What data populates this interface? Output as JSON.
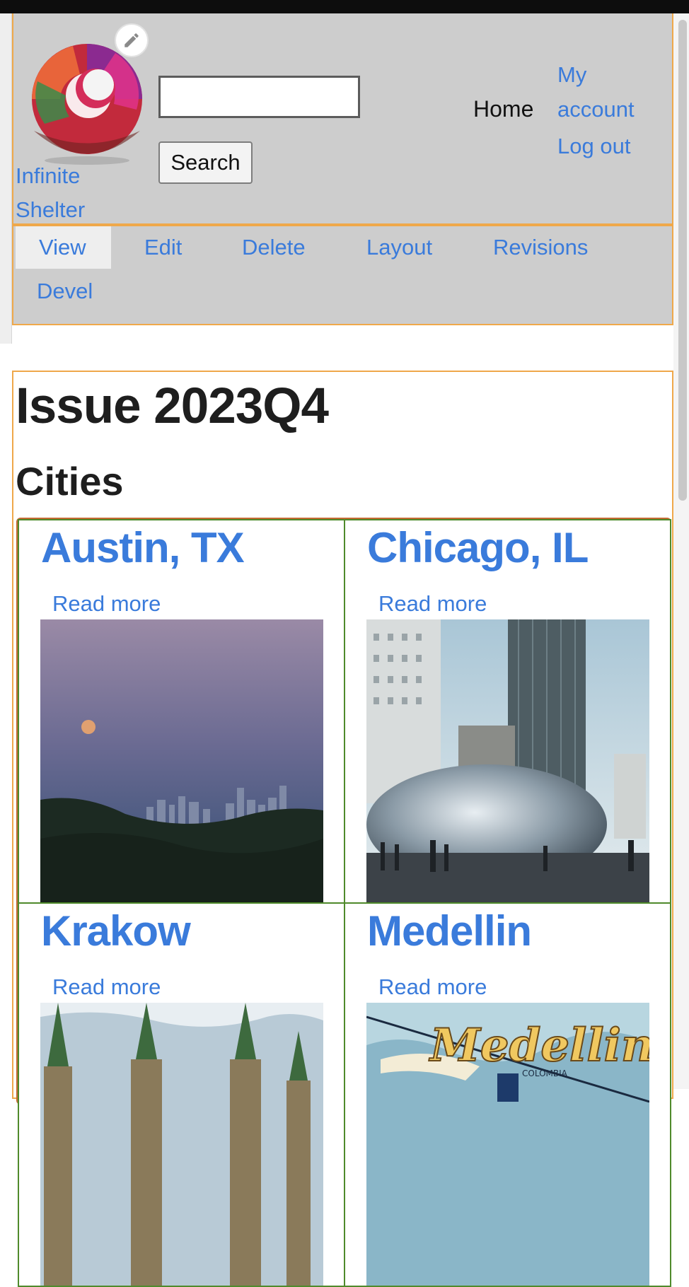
{
  "header": {
    "site_name": "Infinite Shelter",
    "search": {
      "value": "",
      "button_label": "Search"
    },
    "nav": {
      "home": "Home",
      "my_account": "My account",
      "log_out": "Log out"
    }
  },
  "tabs": [
    "View",
    "Edit",
    "Delete",
    "Layout",
    "Revisions",
    "Devel"
  ],
  "page": {
    "title": "Issue 2023Q4",
    "section": "Cities"
  },
  "cards": [
    {
      "title": "Austin, TX",
      "read_more": "Read more"
    },
    {
      "title": "Chicago, IL",
      "read_more": "Read more"
    },
    {
      "title": "Krakow",
      "read_more": "Read more"
    },
    {
      "title": "Medellin",
      "read_more": "Read more"
    }
  ],
  "poster_text": {
    "main": "Medellin",
    "sub": "COLOMBIA"
  },
  "colors": {
    "link": "#3a7bdb",
    "header_bg": "#cdcdcd",
    "frame_orange": "#efa84a",
    "card_border": "#4f8a2b"
  }
}
